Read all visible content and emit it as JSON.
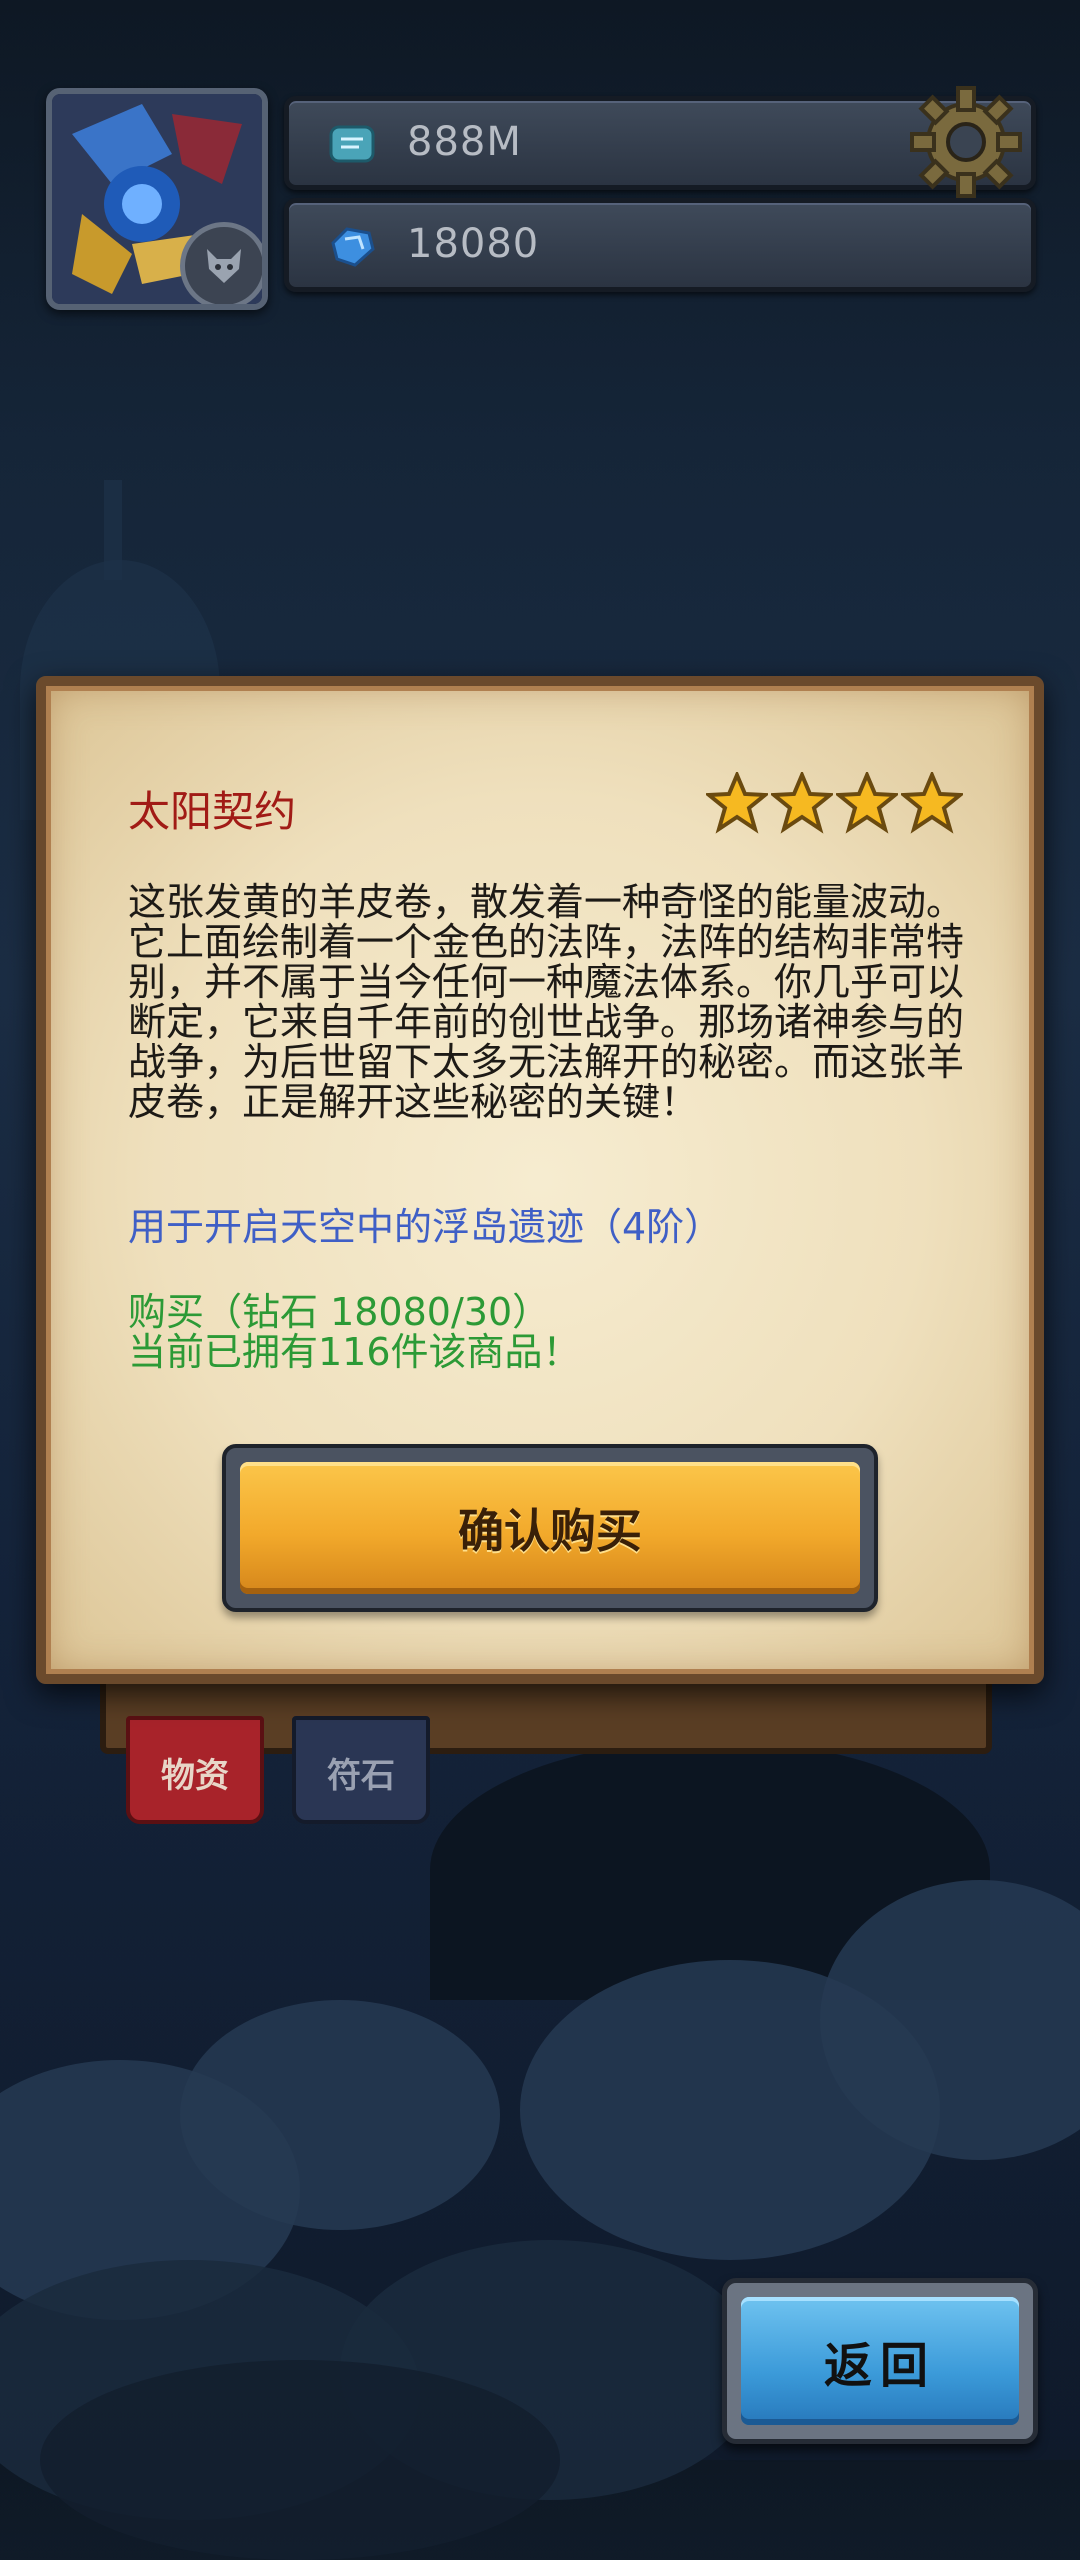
{
  "resources": {
    "gold": {
      "value": "888M",
      "icon": "scroll-coin-icon"
    },
    "diamonds": {
      "value": "18080",
      "icon": "diamond-icon"
    }
  },
  "tabs": [
    {
      "label": "物资",
      "active": true
    },
    {
      "label": "符石",
      "active": false
    }
  ],
  "item": {
    "name": "太阳契约",
    "stars": 4,
    "description": "这张发黄的羊皮卷，散发着一种奇怪的能量波动。它上面绘制着一个金色的法阵，法阵的结构非常特别，并不属于当今任何一种魔法体系。你几乎可以断定，它来自千年前的创世战争。那场诸神参与的战争，为后世留下太多无法解开的秘密。而这张羊皮卷，正是解开这些秘密的关键！",
    "usage": "用于开启天空中的浮岛遗迹（4阶）",
    "buy_line": "购买（钻石 18080/30）",
    "owned_line": "当前已拥有116件该商品！"
  },
  "buttons": {
    "confirm": "确认购买",
    "back": "返回"
  },
  "colors": {
    "title": "#a11b16",
    "usage": "#3f5fc6",
    "buy": "#2c9a36",
    "confirm": "#f2a92b",
    "back": "#3b9ad9"
  }
}
